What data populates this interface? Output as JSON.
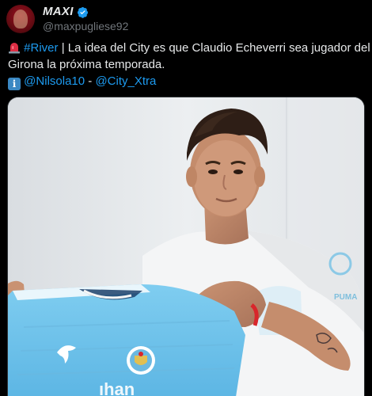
{
  "author": {
    "display_name": "MAXI",
    "handle": "@maxpugliese92",
    "verified": true,
    "avatar_icon": "avatar-photo"
  },
  "tweet": {
    "line1_emoji": "siren-emoji",
    "line1_hashtag": "#River",
    "line1_text": " | La idea del City es que Claudio Echeverri sea jugador del",
    "line2_text": "Girona la próxima temporada.",
    "line3_emoji": "info-emoji",
    "line3_mention1": "@Nilsola10",
    "line3_sep": " - ",
    "line3_mention2": "@City_Xtra"
  },
  "colors": {
    "background": "#000000",
    "text": "#e7e9ea",
    "secondary": "#71767b",
    "link": "#1d9bf0",
    "verified": "#1d9bf0",
    "jersey": "#6cc2ea"
  },
  "media": {
    "type": "photo",
    "subject_icon": "player-holding-jersey-photo"
  }
}
